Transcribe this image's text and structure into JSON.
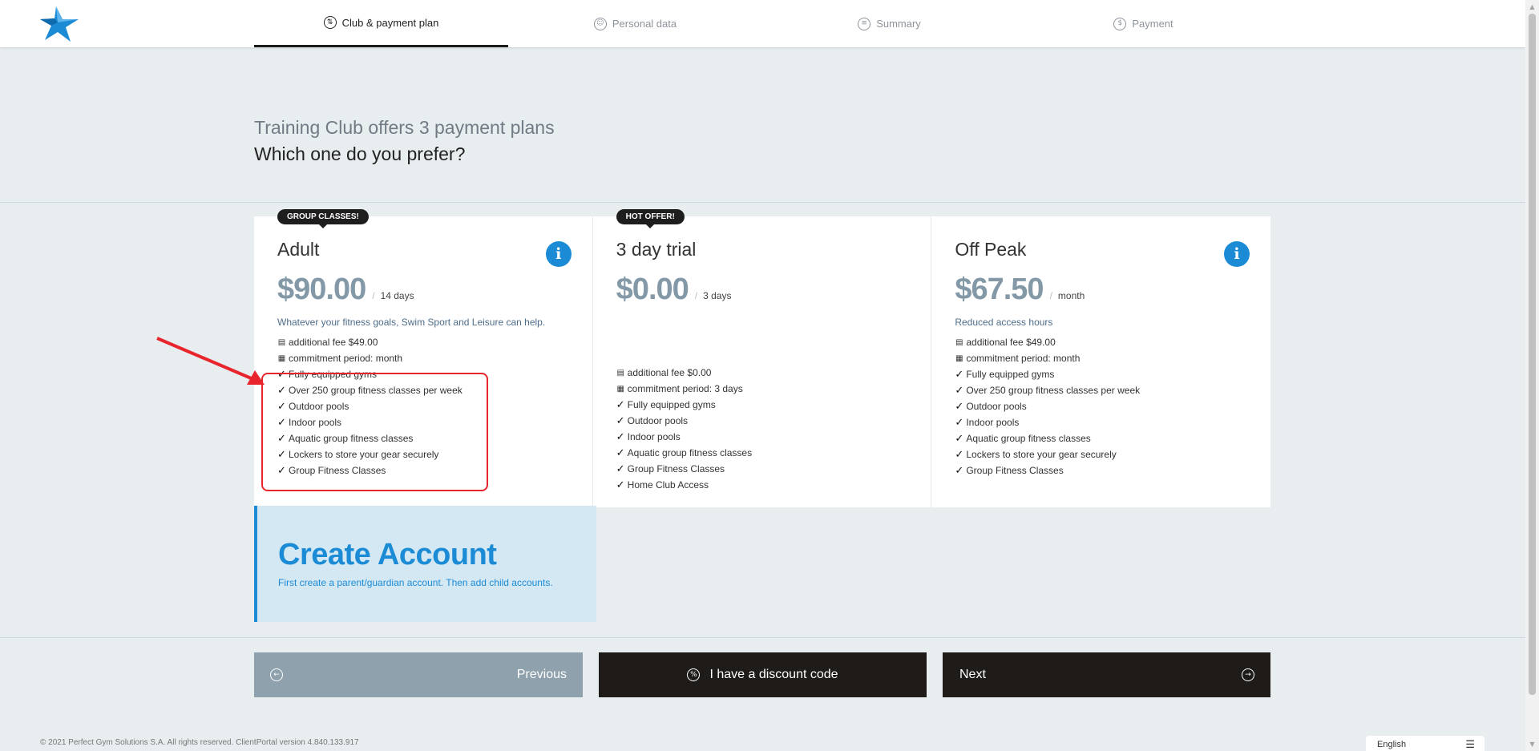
{
  "header": {
    "logo": "star-logo",
    "steps": [
      {
        "label": "Club & payment plan",
        "icon": "swap-icon",
        "glyph": "⇅",
        "active": true
      },
      {
        "label": "Personal data",
        "icon": "person-icon",
        "glyph": "☺",
        "active": false
      },
      {
        "label": "Summary",
        "icon": "list-icon",
        "glyph": "≡",
        "active": false
      },
      {
        "label": "Payment",
        "icon": "dollar-icon",
        "glyph": "$",
        "active": false
      }
    ]
  },
  "heading": {
    "line1": "Training Club offers 3 payment plans",
    "line2": "Which one do you prefer?"
  },
  "plans": [
    {
      "badge": "GROUP CLASSES!",
      "name": "Adult",
      "price": "$90.00",
      "separator": "/",
      "period": "14 days",
      "description": "Whatever your fitness goals, Swim Sport and Leisure can help.",
      "fee": "additional fee $49.00",
      "commitment": "commitment period: month",
      "features": [
        "Fully equipped gyms",
        "Over 250 group fitness classes per week",
        "Outdoor pools",
        "Indoor pools",
        "Aquatic group fitness classes",
        "Lockers to store your gear securely",
        "Group Fitness Classes"
      ]
    },
    {
      "badge": "HOT OFFER!",
      "name": "3 day trial",
      "price": "$0.00",
      "separator": "/",
      "period": "3 days",
      "description": "",
      "fee": "additional fee $0.00",
      "commitment": "commitment period: 3 days",
      "features": [
        "Fully equipped gyms",
        "Outdoor pools",
        "Indoor pools",
        "Aquatic group fitness classes",
        "Group Fitness Classes",
        "Home Club Access"
      ]
    },
    {
      "badge": "",
      "name": "Off Peak",
      "price": "$67.50",
      "separator": "/",
      "period": "month",
      "description": "Reduced access hours",
      "fee": "additional fee $49.00",
      "commitment": "commitment period: month",
      "features": [
        "Fully equipped gyms",
        "Over 250 group fitness classes per week",
        "Outdoor pools",
        "Indoor pools",
        "Aquatic group fitness classes",
        "Lockers to store your gear securely",
        "Group Fitness Classes"
      ]
    }
  ],
  "create_account": {
    "title": "Create Account",
    "text": "First create a parent/guardian account. Then add child accounts."
  },
  "buttons": {
    "previous": "Previous",
    "discount": "I have a discount code",
    "next": "Next"
  },
  "footer": {
    "copyright": "© 2021 Perfect Gym Solutions S.A. All rights reserved. ClientPortal version 4.840.133.917",
    "language": "English"
  },
  "colors": {
    "accent": "#1b8bd6",
    "price": "#8499a7",
    "dark_button": "#1e1b19",
    "prev_button": "#8ea1ad",
    "annotation": "#e8252d"
  }
}
